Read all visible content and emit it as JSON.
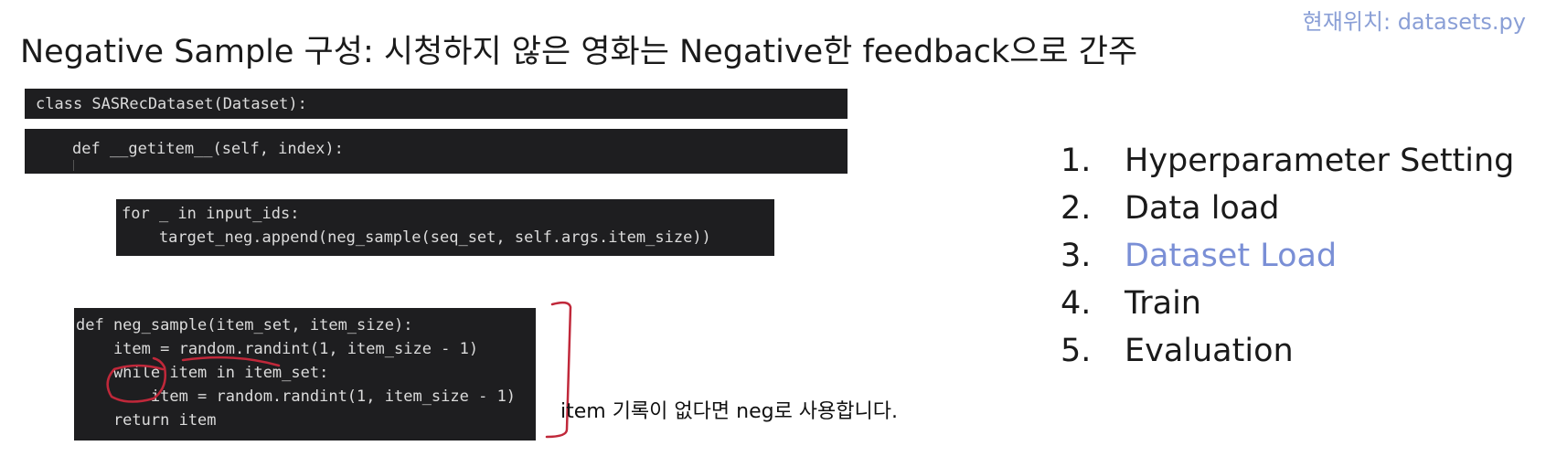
{
  "location": "현재위치: datasets.py",
  "title": "Negative Sample 구성: 시청하지 않은 영화는 Negative한 feedback으로 간주",
  "code_class": "class SASRecDataset(Dataset):",
  "code_getitem": "def __getitem__(self, index):",
  "code_loop": {
    "line1": "for _ in input_ids:",
    "line2": "    target_neg.append(neg_sample(seq_set, self.args.item_size))"
  },
  "code_neg_sample": {
    "line1": "def neg_sample(item_set, item_size):",
    "line2": "    item = random.randint(1, item_size - 1)",
    "line3": "    while item in item_set:",
    "line4": "        item = random.randint(1, item_size - 1)",
    "line5": "    return item"
  },
  "steps": [
    {
      "number": "1.",
      "label": "Hyperparameter Setting"
    },
    {
      "number": "2.",
      "label": "Data load"
    },
    {
      "number": "3.",
      "label": "Dataset Load"
    },
    {
      "number": "4.",
      "label": "Train"
    },
    {
      "number": "5.",
      "label": "Evaluation"
    }
  ],
  "annotation": "item 기록이 없다면 neg로 사용합니다.",
  "colors": {
    "highlight": "#7a8fd6",
    "annotation_ink": "#c0283a",
    "code_bg": "#1e1e20"
  }
}
